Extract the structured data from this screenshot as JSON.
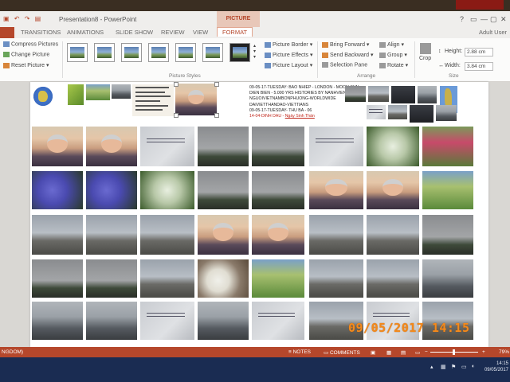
{
  "window": {
    "title": "Presentation8 - PowerPoint",
    "contextual_tab_group": "PICTURE TOOLS",
    "user": "Adult User",
    "buttons": [
      "?",
      "▭",
      "—",
      "▢",
      "✕"
    ]
  },
  "tabs": [
    "TRANSITIONS",
    "ANIMATIONS",
    "SLIDE SHOW",
    "REVIEW",
    "VIEW",
    "FORMAT"
  ],
  "active_tab": "FORMAT",
  "ribbon": {
    "adjust": {
      "compress": "Compress Pictures",
      "change": "Change Picture",
      "reset": "Reset Picture"
    },
    "picture_styles_label": "Picture Styles",
    "style_options": [
      "Picture Border",
      "Picture Effects",
      "Picture Layout"
    ],
    "arrange": {
      "label": "Arrange",
      "bring_forward": "Bring Forward",
      "send_backward": "Send Backward",
      "selection_pane": "Selection Pane",
      "align": "Align",
      "group": "Group",
      "rotate": "Rotate"
    },
    "size": {
      "label": "Size",
      "crop": "Crop",
      "height_label": "Height:",
      "height_value": "2.88 cm",
      "width_label": "Width:",
      "width_value": "3.84 cm"
    }
  },
  "slide_caption": {
    "line1": "09-05-17-TUESDAY: BAO NHIEP - LONDON - MOON SUN",
    "line2": "DIEN BIEN - 5.000 YRS HISTORIES BY NANHVIEN",
    "line3": "NGUOIVIETNAMBONPHUONG-WORLDWIDE",
    "line4": "DAIVIETTHANDAO-VIETTIANS",
    "line5": "09-05-17-TUESDAY- THU BA - 06",
    "line6_prefix": "14-04-DINH DAU - ",
    "line6_link": "Ngày Sinh Thần"
  },
  "status": {
    "left": "NGDOM)",
    "notes": "NOTES",
    "comments": "COMMENTS",
    "zoom": "79%"
  },
  "taskbar": {
    "time": "14:15",
    "date": "09/05/2017"
  },
  "photo_stamp": "09/05/2017  14:15",
  "colors": {
    "accent": "#b5472b",
    "stamp": "#f38a1c",
    "taskbar": "#1a2c52"
  }
}
